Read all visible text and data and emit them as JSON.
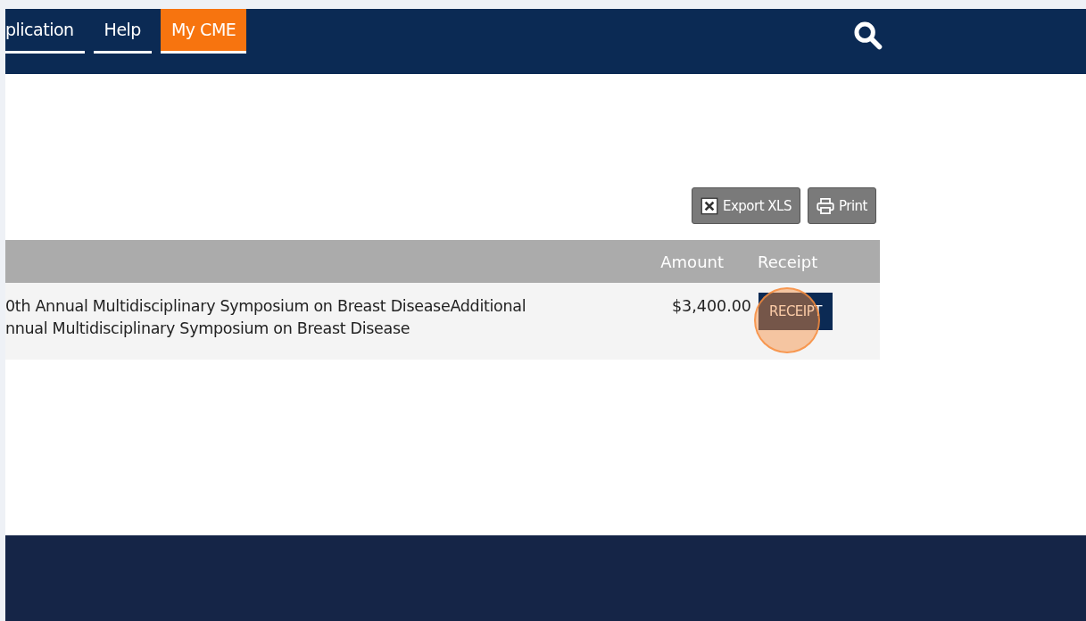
{
  "nav": {
    "items": [
      {
        "label": "plication",
        "selected": false
      },
      {
        "label": "Help",
        "selected": false
      },
      {
        "label": "My CME",
        "selected": true
      }
    ]
  },
  "toolbar": {
    "buttons": [
      {
        "kind": "export",
        "label": "Export XLS"
      },
      {
        "kind": "print",
        "label": "Print"
      }
    ]
  },
  "table": {
    "columns": [
      "Amount",
      "Receipt"
    ],
    "rows": [
      {
        "description": [
          "0th Annual Multidisciplinary Symposium on Breast DiseaseAdditional",
          "nnual Multidisciplinary Symposium on Breast Disease"
        ],
        "amount": "$3,400.00",
        "receipt": "RECEIPT",
        "clicked": true
      }
    ]
  }
}
